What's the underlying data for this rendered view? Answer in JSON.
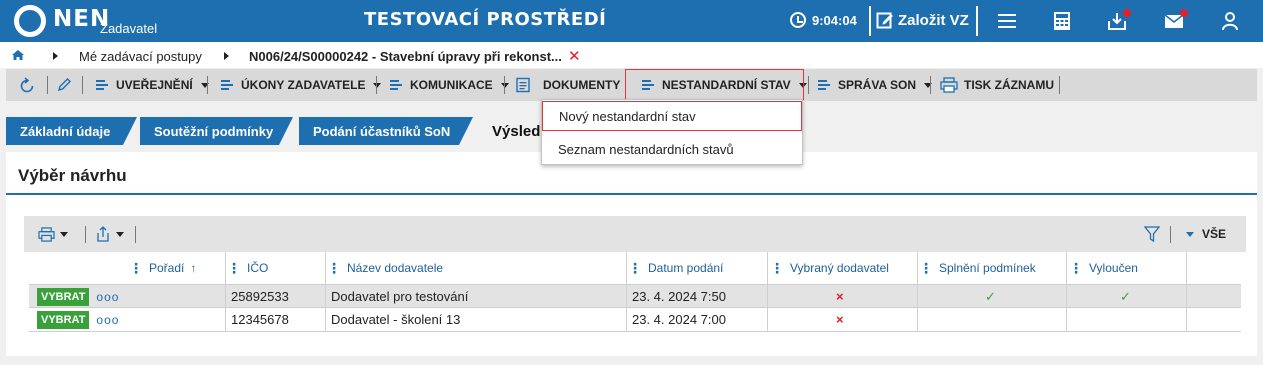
{
  "header": {
    "logo_text": "NEN",
    "logo_sub": "Zadavatel",
    "title": "TESTOVACÍ PROSTŘEDÍ",
    "time": "9:04:04",
    "create_label": "Založit VZ",
    "accent": "#1e6fb0",
    "icons": [
      "clock-icon",
      "edit-icon",
      "menu-icon",
      "calculator-icon",
      "inbox-icon",
      "mail-icon",
      "user-icon"
    ]
  },
  "breadcrumb": {
    "items": [
      "Mé zadávací postupy",
      "N006/24/S00000242 - Stavební úpravy při rekonst..."
    ]
  },
  "toolbar": {
    "items": [
      "UVEŘEJNĚNÍ",
      "ÚKONY ZADAVATELE",
      "KOMUNIKACE",
      "DOKUMENTY",
      "NESTANDARDNÍ STAV",
      "SPRÁVA SON",
      "TISK ZÁZNAMU"
    ]
  },
  "dropdown": {
    "items": [
      "Nový nestandardní stav",
      "Seznam nestandardních stavů"
    ]
  },
  "tabs": {
    "items": [
      "Základní údaje",
      "Soutěžní podmínky",
      "Podání účastníků SoN"
    ],
    "active": "Výsledek"
  },
  "panel": {
    "title": "Výběr návrhu"
  },
  "grid": {
    "filter_all": "VŠE",
    "columns": [
      "Pořadí",
      "IČO",
      "Název dodavatele",
      "Datum podání",
      "Vybraný dodavatel",
      "Splnění podmínek",
      "Vyloučen"
    ],
    "select_label": "VYBRAT",
    "more_label": "ooo",
    "rows": [
      {
        "ico": "25892533",
        "name": "Dodavatel pro testování",
        "date": "23. 4. 2024 7:50",
        "selected": "×",
        "met": "✓",
        "excluded": "✓"
      },
      {
        "ico": "12345678",
        "name": "Dodavatel - školení 13",
        "date": "23. 4. 2024 7:00",
        "selected": "×",
        "met": "",
        "excluded": ""
      }
    ]
  }
}
